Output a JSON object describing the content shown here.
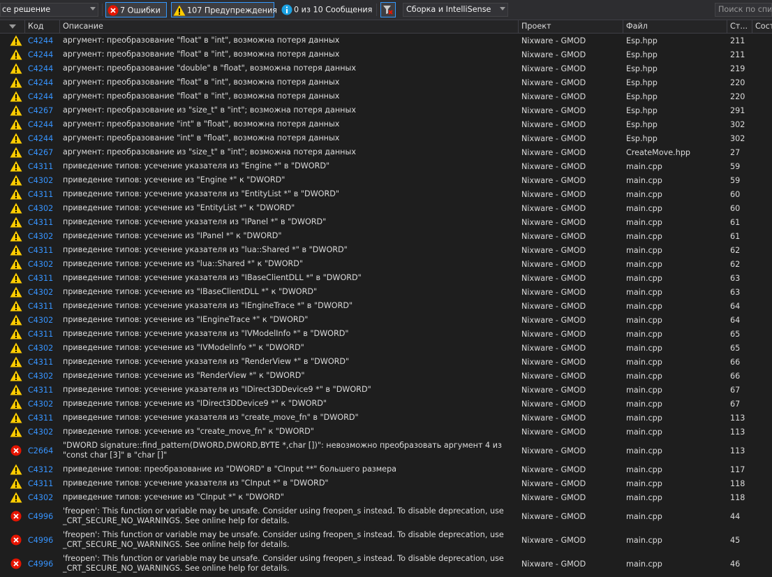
{
  "toolbar": {
    "scope_value": "се решение",
    "errors_label": "7 Ошибки",
    "warnings_label": "107 Предупреждения",
    "messages_label": "0 из 10 Сообщения",
    "build_filter": "Сборка и IntelliSense",
    "search_placeholder": "Поиск по спис"
  },
  "columns": {
    "code": "Код",
    "description": "Описание",
    "project": "Проект",
    "file": "Файл",
    "line": "Ст...",
    "state": "Сост"
  },
  "colors": {
    "error": "#e51400",
    "warning": "#ffcc00",
    "info": "#1ba1e2",
    "code_link": "#3794ff",
    "background": "#1e1e1e"
  },
  "rows": [
    {
      "type": "warning",
      "code": "C4244",
      "desc": "аргумент: преобразование \"float\" в \"int\", возможна потеря данных",
      "project": "Nixware - GMOD",
      "file": "Esp.hpp",
      "line": "211"
    },
    {
      "type": "warning",
      "code": "C4244",
      "desc": "аргумент: преобразование \"float\" в \"int\", возможна потеря данных",
      "project": "Nixware - GMOD",
      "file": "Esp.hpp",
      "line": "211"
    },
    {
      "type": "warning",
      "code": "C4244",
      "desc": "аргумент: преобразование \"double\" в \"float\", возможна потеря данных",
      "project": "Nixware - GMOD",
      "file": "Esp.hpp",
      "line": "219"
    },
    {
      "type": "warning",
      "code": "C4244",
      "desc": "аргумент: преобразование \"float\" в \"int\", возможна потеря данных",
      "project": "Nixware - GMOD",
      "file": "Esp.hpp",
      "line": "220"
    },
    {
      "type": "warning",
      "code": "C4244",
      "desc": "аргумент: преобразование \"float\" в \"int\", возможна потеря данных",
      "project": "Nixware - GMOD",
      "file": "Esp.hpp",
      "line": "220"
    },
    {
      "type": "warning",
      "code": "C4267",
      "desc": "аргумент: преобразование из \"size_t\" в \"int\"; возможна потеря данных",
      "project": "Nixware - GMOD",
      "file": "Esp.hpp",
      "line": "291"
    },
    {
      "type": "warning",
      "code": "C4244",
      "desc": "аргумент: преобразование \"int\" в \"float\", возможна потеря данных",
      "project": "Nixware - GMOD",
      "file": "Esp.hpp",
      "line": "302"
    },
    {
      "type": "warning",
      "code": "C4244",
      "desc": "аргумент: преобразование \"int\" в \"float\", возможна потеря данных",
      "project": "Nixware - GMOD",
      "file": "Esp.hpp",
      "line": "302"
    },
    {
      "type": "warning",
      "code": "C4267",
      "desc": "аргумент: преобразование из \"size_t\" в \"int\"; возможна потеря данных",
      "project": "Nixware - GMOD",
      "file": "CreateMove.hpp",
      "line": "27"
    },
    {
      "type": "warning",
      "code": "C4311",
      "desc": "приведение типов: усечение указателя из \"Engine *\" в \"DWORD\"",
      "project": "Nixware - GMOD",
      "file": "main.cpp",
      "line": "59"
    },
    {
      "type": "warning",
      "code": "C4302",
      "desc": "приведение типов: усечение из \"Engine *\" к \"DWORD\"",
      "project": "Nixware - GMOD",
      "file": "main.cpp",
      "line": "59"
    },
    {
      "type": "warning",
      "code": "C4311",
      "desc": "приведение типов: усечение указателя из \"EntityList *\" в \"DWORD\"",
      "project": "Nixware - GMOD",
      "file": "main.cpp",
      "line": "60"
    },
    {
      "type": "warning",
      "code": "C4302",
      "desc": "приведение типов: усечение из \"EntityList *\" к \"DWORD\"",
      "project": "Nixware - GMOD",
      "file": "main.cpp",
      "line": "60"
    },
    {
      "type": "warning",
      "code": "C4311",
      "desc": "приведение типов: усечение указателя из \"IPanel *\" в \"DWORD\"",
      "project": "Nixware - GMOD",
      "file": "main.cpp",
      "line": "61"
    },
    {
      "type": "warning",
      "code": "C4302",
      "desc": "приведение типов: усечение из \"IPanel *\" к \"DWORD\"",
      "project": "Nixware - GMOD",
      "file": "main.cpp",
      "line": "61"
    },
    {
      "type": "warning",
      "code": "C4311",
      "desc": "приведение типов: усечение указателя из \"lua::Shared *\" в \"DWORD\"",
      "project": "Nixware - GMOD",
      "file": "main.cpp",
      "line": "62"
    },
    {
      "type": "warning",
      "code": "C4302",
      "desc": "приведение типов: усечение из \"lua::Shared *\" к \"DWORD\"",
      "project": "Nixware - GMOD",
      "file": "main.cpp",
      "line": "62"
    },
    {
      "type": "warning",
      "code": "C4311",
      "desc": "приведение типов: усечение указателя из \"IBaseClientDLL *\" в \"DWORD\"",
      "project": "Nixware - GMOD",
      "file": "main.cpp",
      "line": "63"
    },
    {
      "type": "warning",
      "code": "C4302",
      "desc": "приведение типов: усечение из \"IBaseClientDLL *\" к \"DWORD\"",
      "project": "Nixware - GMOD",
      "file": "main.cpp",
      "line": "63"
    },
    {
      "type": "warning",
      "code": "C4311",
      "desc": "приведение типов: усечение указателя из \"IEngineTrace *\" в \"DWORD\"",
      "project": "Nixware - GMOD",
      "file": "main.cpp",
      "line": "64"
    },
    {
      "type": "warning",
      "code": "C4302",
      "desc": "приведение типов: усечение из \"IEngineTrace *\" к \"DWORD\"",
      "project": "Nixware - GMOD",
      "file": "main.cpp",
      "line": "64"
    },
    {
      "type": "warning",
      "code": "C4311",
      "desc": "приведение типов: усечение указателя из \"IVModelInfo *\" в \"DWORD\"",
      "project": "Nixware - GMOD",
      "file": "main.cpp",
      "line": "65"
    },
    {
      "type": "warning",
      "code": "C4302",
      "desc": "приведение типов: усечение из \"IVModelInfo *\" к \"DWORD\"",
      "project": "Nixware - GMOD",
      "file": "main.cpp",
      "line": "65"
    },
    {
      "type": "warning",
      "code": "C4311",
      "desc": "приведение типов: усечение указателя из \"RenderView *\" в \"DWORD\"",
      "project": "Nixware - GMOD",
      "file": "main.cpp",
      "line": "66"
    },
    {
      "type": "warning",
      "code": "C4302",
      "desc": "приведение типов: усечение из \"RenderView *\" к \"DWORD\"",
      "project": "Nixware - GMOD",
      "file": "main.cpp",
      "line": "66"
    },
    {
      "type": "warning",
      "code": "C4311",
      "desc": "приведение типов: усечение указателя из \"IDirect3DDevice9 *\" в \"DWORD\"",
      "project": "Nixware - GMOD",
      "file": "main.cpp",
      "line": "67"
    },
    {
      "type": "warning",
      "code": "C4302",
      "desc": "приведение типов: усечение из \"IDirect3DDevice9 *\" к \"DWORD\"",
      "project": "Nixware - GMOD",
      "file": "main.cpp",
      "line": "67"
    },
    {
      "type": "warning",
      "code": "C4311",
      "desc": "приведение типов: усечение указателя из \"create_move_fn\" в \"DWORD\"",
      "project": "Nixware - GMOD",
      "file": "main.cpp",
      "line": "113"
    },
    {
      "type": "warning",
      "code": "C4302",
      "desc": "приведение типов: усечение из \"create_move_fn\" к \"DWORD\"",
      "project": "Nixware - GMOD",
      "file": "main.cpp",
      "line": "113"
    },
    {
      "type": "error",
      "code": "C2664",
      "desc": "\"DWORD signature::find_pattern(DWORD,DWORD,BYTE *,char [])\": невозможно преобразовать аргумент 4 из \"const char [3]\" в \"char []\"",
      "project": "Nixware - GMOD",
      "file": "main.cpp",
      "line": "113",
      "tall": true
    },
    {
      "type": "warning",
      "code": "C4312",
      "desc": "приведение типов: преобразование из \"DWORD\" в \"CInput **\" большего размера",
      "project": "Nixware - GMOD",
      "file": "main.cpp",
      "line": "117"
    },
    {
      "type": "warning",
      "code": "C4311",
      "desc": "приведение типов: усечение указателя из \"CInput *\" в \"DWORD\"",
      "project": "Nixware - GMOD",
      "file": "main.cpp",
      "line": "118"
    },
    {
      "type": "warning",
      "code": "C4302",
      "desc": "приведение типов: усечение из \"CInput *\" к \"DWORD\"",
      "project": "Nixware - GMOD",
      "file": "main.cpp",
      "line": "118"
    },
    {
      "type": "error",
      "code": "C4996",
      "desc": "'freopen': This function or variable may be unsafe. Consider using freopen_s instead. To disable deprecation, use _CRT_SECURE_NO_WARNINGS. See online help for details.",
      "project": "Nixware - GMOD",
      "file": "main.cpp",
      "line": "44",
      "tall": true
    },
    {
      "type": "error",
      "code": "C4996",
      "desc": "'freopen': This function or variable may be unsafe. Consider using freopen_s instead. To disable deprecation, use _CRT_SECURE_NO_WARNINGS. See online help for details.",
      "project": "Nixware - GMOD",
      "file": "main.cpp",
      "line": "45",
      "tall": true
    },
    {
      "type": "error",
      "code": "C4996",
      "desc": "'freopen': This function or variable may be unsafe. Consider using freopen_s instead. To disable deprecation, use _CRT_SECURE_NO_WARNINGS. See online help for details.",
      "project": "Nixware - GMOD",
      "file": "main.cpp",
      "line": "46",
      "tall": true
    }
  ]
}
